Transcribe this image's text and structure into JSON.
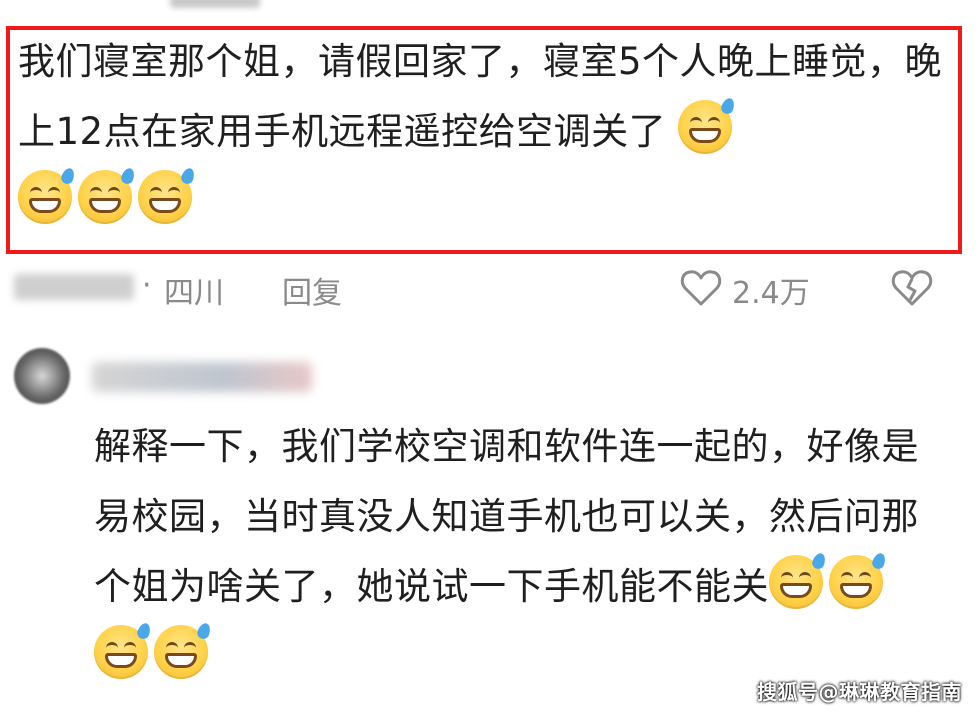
{
  "comment1": {
    "text": "我们寝室那个姐，请假回家了，寝室5个人晚上睡觉，晚上12点在家用手机远程遥控给空调关了",
    "emoji_count": 4
  },
  "meta": {
    "dot": "·",
    "location": "四川",
    "reply_label": "回复",
    "like_count": "2.4万"
  },
  "comment2": {
    "text": "解释一下，我们学校空调和软件连一起的，好像是易校园，当时真没人知道手机也可以关，然后问那个姐为啥关了，她说试一下手机能不能关",
    "emoji_count": 4
  },
  "watermark": "搜狐号@琳琳教育指南",
  "icons": {
    "like": "heart-outline-icon",
    "dislike": "broken-heart-icon",
    "emoji": "grinning-sweat-emoji-icon"
  },
  "colors": {
    "highlight_border": "#f01a1a",
    "meta_text": "#8a8a8a",
    "body_text": "#1f1f1f"
  }
}
